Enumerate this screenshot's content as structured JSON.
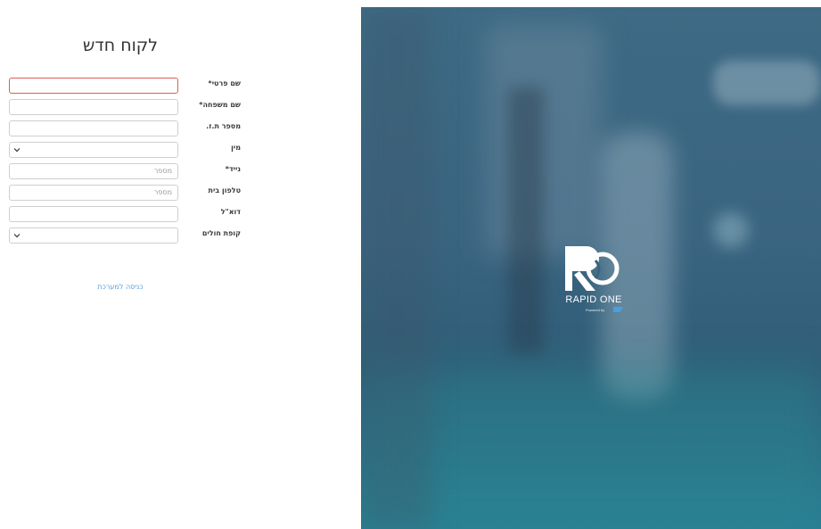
{
  "page": {
    "title": "לקוח חדש"
  },
  "form": {
    "fields": [
      {
        "label": "שם פרטי*",
        "type": "text",
        "placeholder": "",
        "state": "error"
      },
      {
        "label": "שם משפחה*",
        "type": "text",
        "placeholder": ""
      },
      {
        "label": "מספר ת.ז.",
        "type": "text",
        "placeholder": ""
      },
      {
        "label": "מין",
        "type": "select",
        "value": ""
      },
      {
        "label": "נייד*",
        "type": "text",
        "placeholder": "מספר"
      },
      {
        "label": "טלפון בית",
        "type": "text",
        "placeholder": "מספר"
      },
      {
        "label": "דוא\"ל",
        "type": "text",
        "placeholder": ""
      },
      {
        "label": "קופת חולים",
        "type": "select",
        "value": ""
      }
    ],
    "login_link": "כניסה למערכת"
  },
  "brand": {
    "name": "RAPID ONE",
    "tagline": "Powered by",
    "logo_icon": "rapid-one-logo-icon",
    "sap_icon": "sap-badge-icon",
    "colors": {
      "accent": "#5b9bd5",
      "error": "#e05d4c",
      "hero": "#3a6480"
    }
  }
}
